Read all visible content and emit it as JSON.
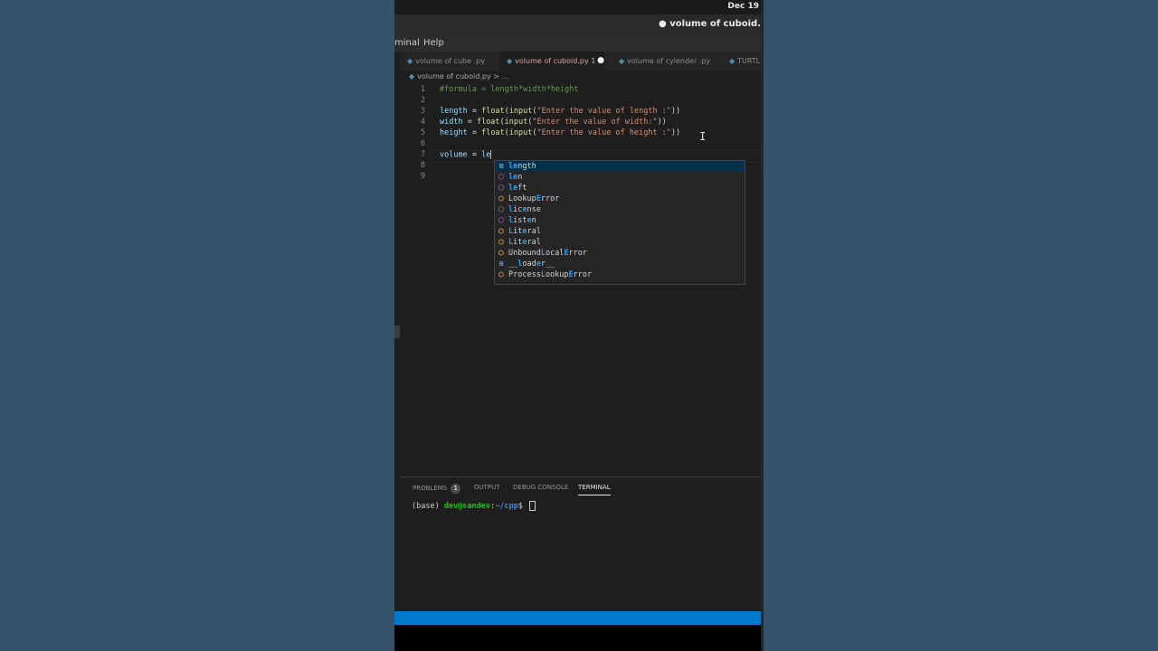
{
  "clock": "Dec 19",
  "window_title": "● volume of cuboid.py - ",
  "menu": [
    {
      "label": "minal"
    },
    {
      "label": "Help"
    }
  ],
  "tabs": [
    {
      "label": "volume of cube .py"
    },
    {
      "label": "volume of cuboid.py 1"
    },
    {
      "label": "volume of cylender .py"
    },
    {
      "label": "TURTL"
    }
  ],
  "breadcrumb": "volume of cuboid.py > ...",
  "line_numbers": [
    "1",
    "2",
    "3",
    "4",
    "5",
    "6",
    "7",
    "8",
    "9"
  ],
  "code": {
    "l1": "#formula = length*width*height",
    "l3_var": "length",
    "l3_eq": " = ",
    "l3_fn1": "float",
    "l3_p1": "(",
    "l3_fn2": "input",
    "l3_p2": "(",
    "l3_str": "\"Enter the value of length :\"",
    "l3_end": "))",
    "l4_var": "width",
    "l4_str": "\"Enter the value of width:\"",
    "l5_var": "height",
    "l5_str": "\"Enter the value of height :\"",
    "l7_var": "volume",
    "l7_eq": " = ",
    "l7_typed": "le"
  },
  "suggestions": [
    {
      "icon": "⊞",
      "pre": "",
      "hl1": "le",
      "post": "ngth"
    },
    {
      "icon": "⬡",
      "pre": "",
      "hl1": "le",
      "post": "n"
    },
    {
      "icon": "⬡",
      "pre": "",
      "hl1": "le",
      "post": "ft"
    },
    {
      "icon": "⛭",
      "pre": "Lookup",
      "hl1": "E",
      "post": "rror"
    },
    {
      "icon": "⬡",
      "pre": "",
      "hl1": "l",
      "post": "ic",
      "hl2": "e",
      "post2": "nse"
    },
    {
      "icon": "⬡",
      "pre": "",
      "hl1": "l",
      "post": "ist",
      "hl2": "e",
      "post2": "n"
    },
    {
      "icon": "⛭",
      "pre": "",
      "hl1": "L",
      "post": "it",
      "hl2": "e",
      "post2": "ral"
    },
    {
      "icon": "⛭",
      "pre": "",
      "hl1": "L",
      "post": "it",
      "hl2": "e",
      "post2": "ral"
    },
    {
      "icon": "⛭",
      "pre": "Unbound",
      "hl1": "L",
      "post": "ocal",
      "hl2": "E",
      "post2": "rror"
    },
    {
      "icon": "⊞",
      "pre": "__",
      "hl1": "l",
      "post": "oad",
      "hl2": "e",
      "post2": "r__"
    },
    {
      "icon": "⛭",
      "pre": "Process",
      "hl1": "L",
      "post": "ookup",
      "hl2": "E",
      "post2": "rror"
    }
  ],
  "panel": {
    "problems": "PROBLEMS",
    "problems_count": "1",
    "output": "OUTPUT",
    "debug": "DEBUG CONSOLE",
    "terminal": "TERMINAL"
  },
  "terminal": {
    "env": "(base) ",
    "user": "dev@sandev",
    "sep": ":",
    "path": "~/cpp",
    "prompt": "$ "
  },
  "colors": {
    "accent": "#007acc",
    "desktop": "#34536b",
    "editor_bg": "#1e1e1e"
  }
}
